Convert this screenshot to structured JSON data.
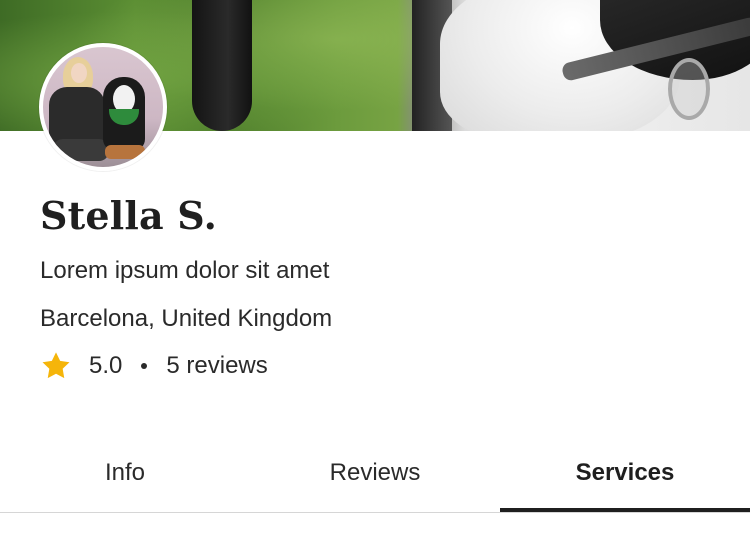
{
  "profile": {
    "name": "Stella S.",
    "tagline": "Lorem ipsum dolor sit amet",
    "location": "Barcelona, United Kingdom",
    "rating": {
      "value": "5.0",
      "reviews_label": "5 reviews",
      "star_icon": "star-icon",
      "star_color": "#F5B50A"
    }
  },
  "tabs": [
    {
      "label": "Info",
      "active": false
    },
    {
      "label": "Reviews",
      "active": false
    },
    {
      "label": "Services",
      "active": true
    }
  ]
}
